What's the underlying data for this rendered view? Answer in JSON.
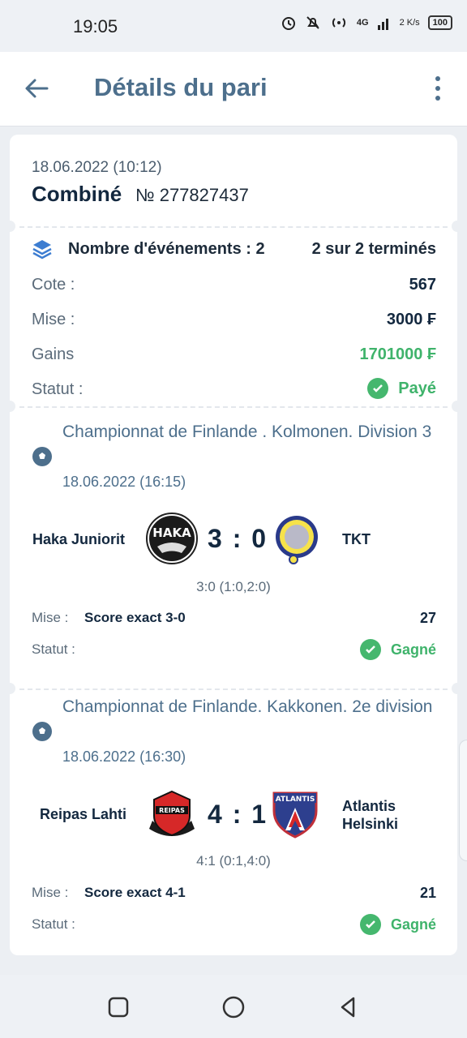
{
  "status_bar": {
    "time": "19:05",
    "network": "4G",
    "speed": "2 K/s",
    "battery": "100",
    "icons": [
      "alarm-icon",
      "mute-icon",
      "hotspot-icon",
      "signal-icon",
      "battery-icon"
    ]
  },
  "header": {
    "title": "Détails du pari",
    "back_icon": "arrow-left-icon",
    "menu_icon": "more-vertical-icon"
  },
  "bet": {
    "date": "18.06.2022 (10:12)",
    "type": "Combiné",
    "number": "№ 277827437",
    "events_label": "Nombre d'événements : 2",
    "events_done": "2 sur 2 terminés",
    "rows": [
      {
        "label": "Cote :",
        "value": "567"
      },
      {
        "label": "Mise :",
        "value": "3000 ₣"
      },
      {
        "label": "Gains",
        "value": "1701000 ₣"
      }
    ],
    "status_label": "Statut :",
    "status_value": "Payé"
  },
  "events": [
    {
      "league": "Championnat de Finlande . Kolmonen. Division 3",
      "date": "18.06.2022 (16:15)",
      "home": "Haka Juniorit",
      "away": "TKT",
      "score": "3 : 0",
      "subscore": "3:0 (1:0,2:0)",
      "mise_label": "Mise :",
      "mise_value": "Score exact 3-0",
      "odd": "27",
      "status_label": "Statut :",
      "status_value": "Gagné",
      "home_logo_text": "HAKA"
    },
    {
      "league": "Championnat de Finlande. Kakkonen. 2e division",
      "date": "18.06.2022 (16:30)",
      "home": "Reipas Lahti",
      "away": "Atlantis Helsinki",
      "score": "4 : 1",
      "subscore": "4:1 (0:1,4:0)",
      "mise_label": "Mise :",
      "mise_value": "Score exact 4-1",
      "odd": "21",
      "status_label": "Statut :",
      "status_value": "Gagné",
      "home_logo_text": "REIPAS",
      "away_logo_text": "ATLANTIS"
    }
  ],
  "colors": {
    "accent": "#4d6f8c",
    "dark": "#13283f",
    "green": "#3fb36b"
  }
}
